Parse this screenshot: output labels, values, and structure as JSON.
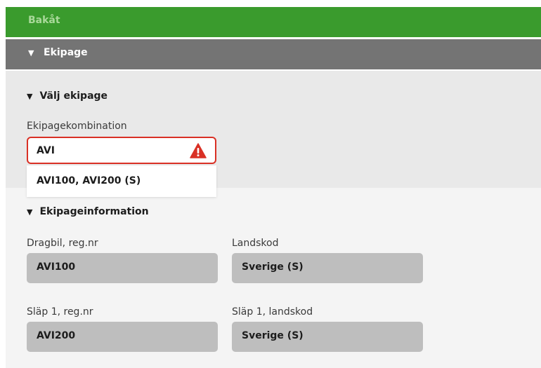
{
  "topbar": {
    "back_label": "Bakåt"
  },
  "section": {
    "title": "Ekipage"
  },
  "select_ekipage": {
    "title": "Välj ekipage",
    "combo_label": "Ekipagekombination",
    "combo_value": "AVI",
    "dropdown_options": [
      "AVI100, AVI200 (S)"
    ]
  },
  "info": {
    "title": "Ekipageinformation",
    "fields": [
      {
        "label": "Dragbil, reg.nr",
        "value": "AVI100"
      },
      {
        "label": "Landskod",
        "value": "Sverige (S)"
      },
      {
        "label": "Släp 1, reg.nr",
        "value": "AVI200"
      },
      {
        "label": "Släp 1, landskod",
        "value": "Sverige (S)"
      }
    ]
  },
  "colors": {
    "topbar": "#3a9b2d",
    "section_header": "#747474",
    "error_border": "#d93025",
    "field_bg": "#bebebe"
  },
  "icons": {
    "collapse": "triangle-down-icon",
    "warning": "warning-icon"
  }
}
